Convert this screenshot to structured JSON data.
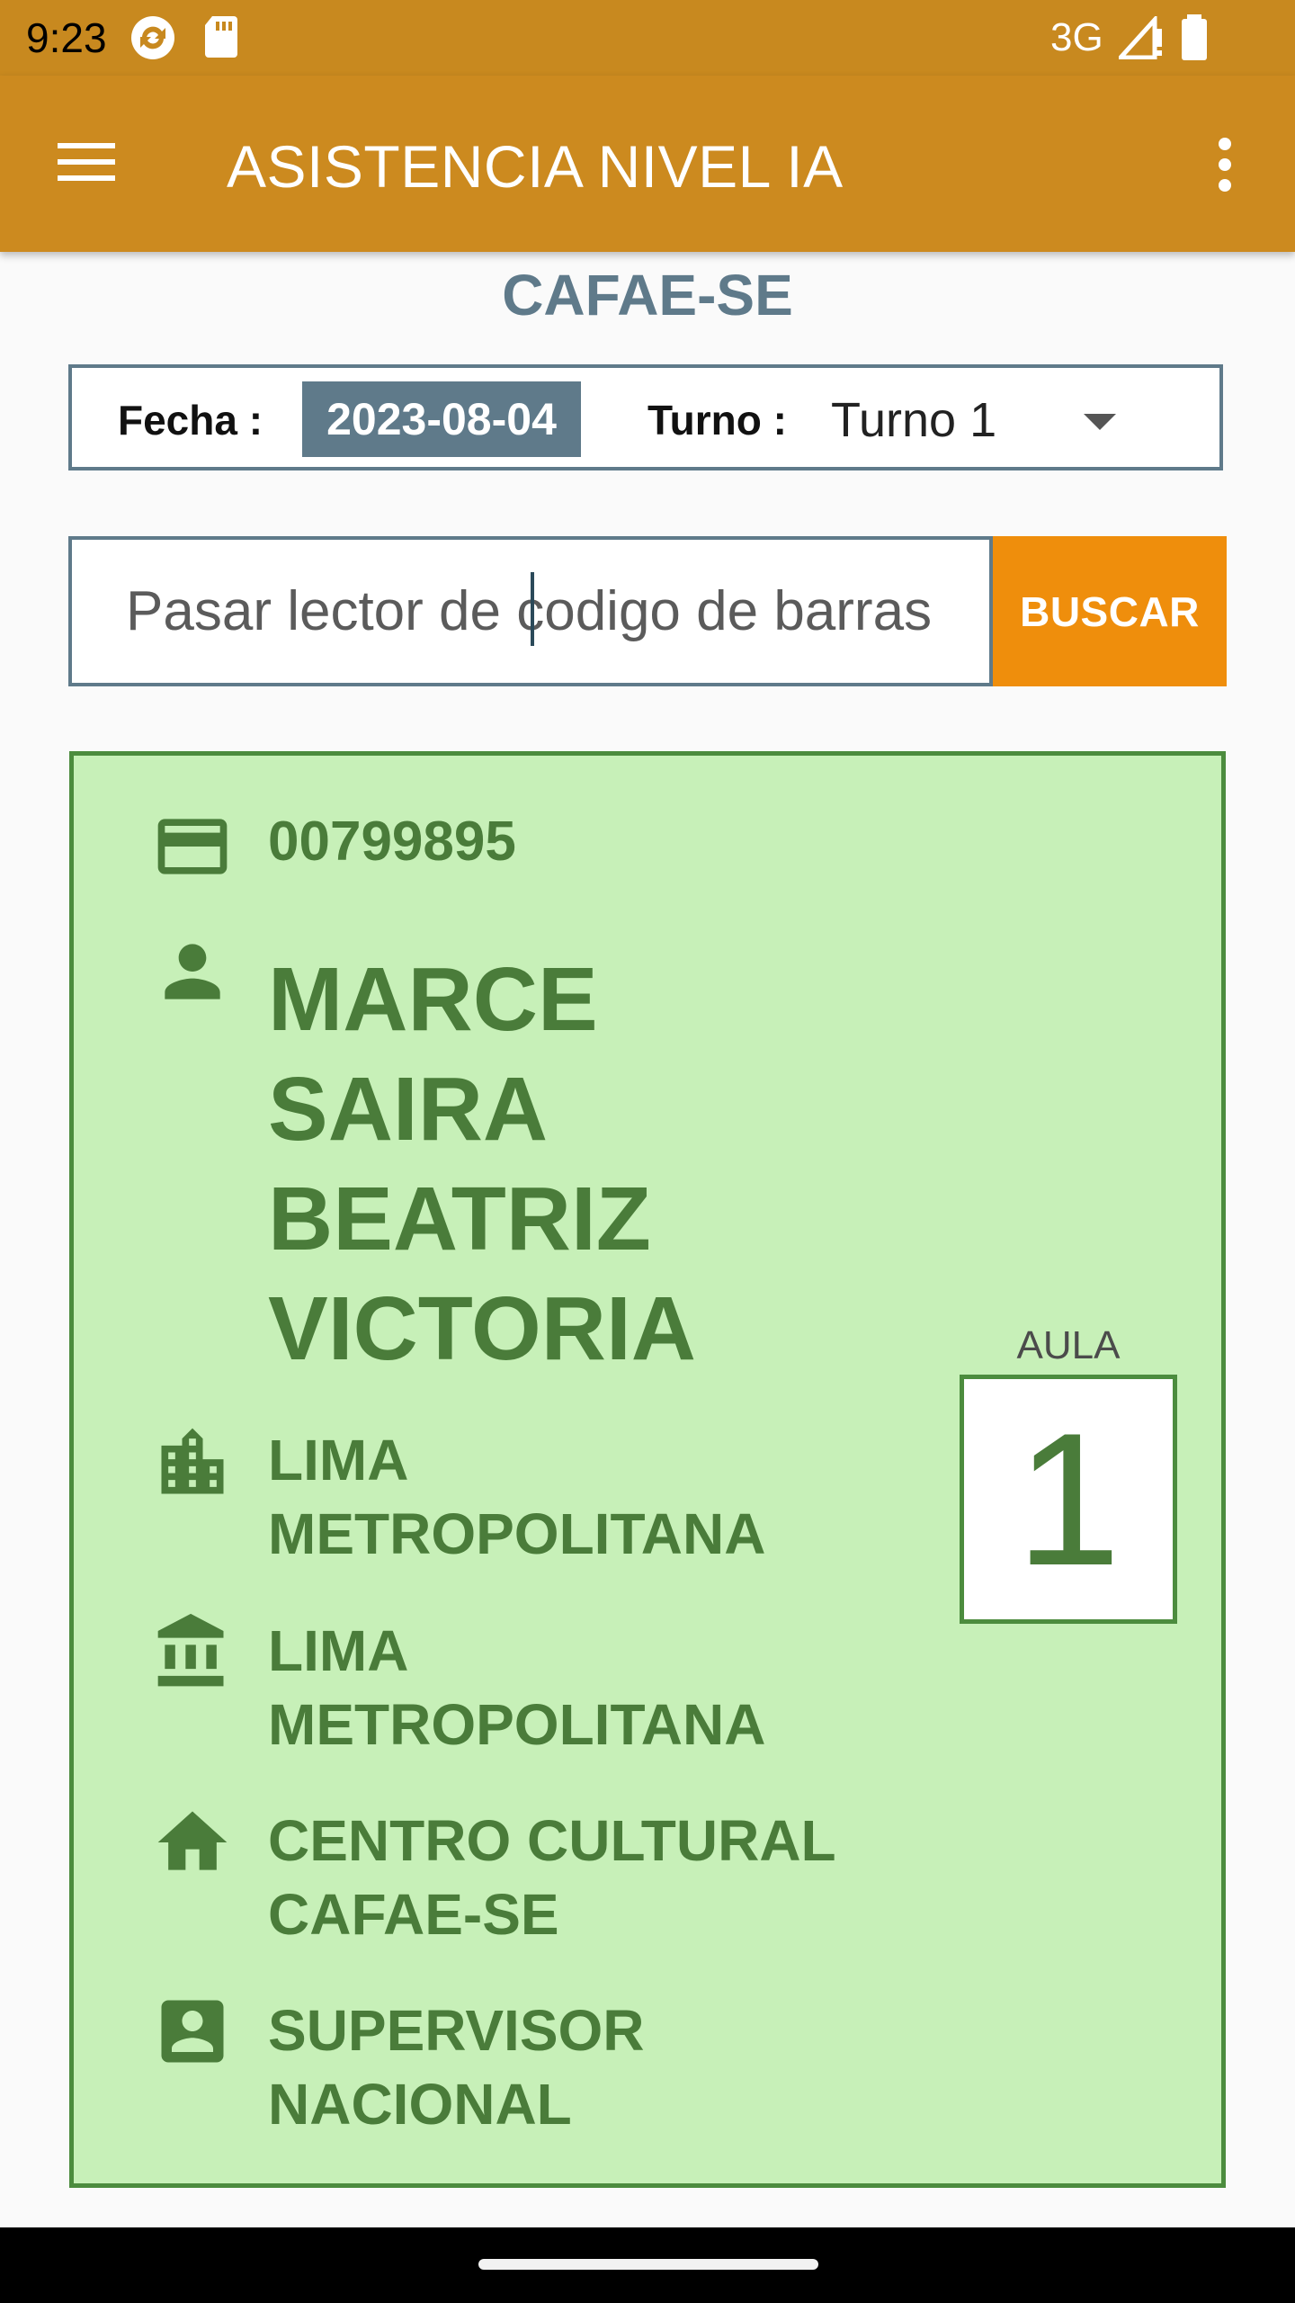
{
  "status_bar": {
    "time": "9:23",
    "network": "3G",
    "icons": [
      "app-sync-icon",
      "sd-card-icon",
      "signal-icon",
      "battery-icon"
    ]
  },
  "app_bar": {
    "title": "ASISTENCIA NIVEL IA",
    "menu_icon": "hamburger-menu-icon",
    "overflow_icon": "more-vert-icon"
  },
  "header": {
    "org": "CAFAE-SE"
  },
  "filter": {
    "fecha_label": "Fecha :",
    "fecha_value": "2023-08-04",
    "turno_label": "Turno :",
    "turno_value": "Turno 1"
  },
  "search": {
    "placeholder": "Pasar lector de codigo de barras",
    "button_label": "BUSCAR"
  },
  "card": {
    "number": "00799895",
    "name": "MARCE SAIRA BEATRIZ VICTORIA",
    "region": "LIMA METROPOLITANA",
    "ugel": "LIMA METROPOLITANA",
    "sede": "CENTRO CULTURAL CAFAE-SE",
    "role": "SUPERVISOR NACIONAL",
    "aula_label": "AULA",
    "aula_number": "1",
    "icons": [
      "credit-card-icon",
      "person-icon",
      "location-city-icon",
      "account-balance-icon",
      "home-icon",
      "badge-icon"
    ],
    "colors": {
      "background": "#c7f0b8",
      "accent": "#4a7c3a"
    }
  },
  "colors": {
    "app_bar": "#cc8a1f",
    "button": "#ef8e0c",
    "header": "#5f7a8a"
  }
}
